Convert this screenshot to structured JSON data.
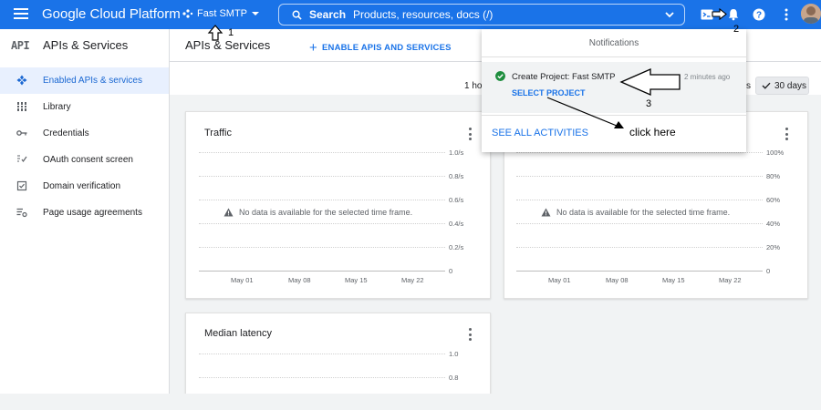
{
  "topbar": {
    "brand": "Google Cloud Platform",
    "project": "Fast SMTP",
    "search_bold": "Search",
    "search_placeholder": "Products, resources, docs (/)"
  },
  "sidebar": {
    "title": "APIs & Services",
    "logo": "API",
    "items": [
      {
        "label": "Enabled APIs & services",
        "icon": "diamond-icon",
        "active": true
      },
      {
        "label": "Library",
        "icon": "library-icon"
      },
      {
        "label": "Credentials",
        "icon": "key-icon"
      },
      {
        "label": "OAuth consent screen",
        "icon": "consent-icon"
      },
      {
        "label": "Domain verification",
        "icon": "checkbox-icon"
      },
      {
        "label": "Page usage agreements",
        "icon": "settings-list-icon"
      }
    ]
  },
  "main": {
    "title": "APIs & Services",
    "enable_label": "ENABLE APIS AND SERVICES",
    "range_1h": "1 ho",
    "range_s": "s",
    "range_selected": "30 days"
  },
  "charts": {
    "traffic": {
      "title": "Traffic",
      "yticks": [
        "1.0/s",
        "0.8/s",
        "0.6/s",
        "0.4/s",
        "0.2/s",
        "0"
      ],
      "xticks": [
        "May 01",
        "May 08",
        "May 15",
        "May 22"
      ],
      "nodata": "No data is available for the selected time frame."
    },
    "errors": {
      "title": "",
      "yticks": [
        "100%",
        "80%",
        "60%",
        "40%",
        "20%",
        "0"
      ],
      "xticks": [
        "May 01",
        "May 08",
        "May 15",
        "May 22"
      ],
      "nodata": "No data is available for the selected time frame."
    },
    "latency": {
      "title": "Median latency",
      "yticks": [
        "1.0",
        "0.8"
      ]
    }
  },
  "notifications": {
    "title": "Notifications",
    "item_text": "Create Project: Fast SMTP",
    "item_time": "2 minutes ago",
    "item_link": "SELECT PROJECT",
    "see_all": "SEE ALL ACTIVITIES"
  },
  "annotations": {
    "label_1": "1",
    "label_2": "2",
    "label_3": "3",
    "click_here": "click here"
  },
  "colors": {
    "accent": "#1a73e8",
    "success": "#1e8e3e"
  }
}
